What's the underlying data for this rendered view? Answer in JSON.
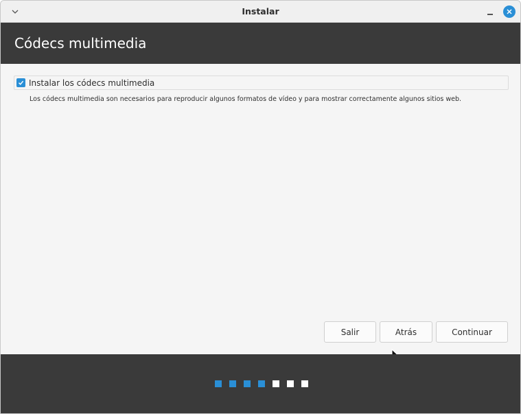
{
  "window": {
    "title": "Instalar"
  },
  "header": {
    "title": "Códecs multimedia"
  },
  "option": {
    "label": "Instalar los códecs multimedia",
    "checked": true
  },
  "description": "Los códecs multimedia son necesarios para reproducir algunos formatos de vídeo y para mostrar correctamente algunos sitios web.",
  "buttons": {
    "quit": "Salir",
    "back": "Atrás",
    "continue": "Continuar"
  },
  "progress": {
    "total_steps": 7,
    "completed_steps": 4,
    "active_color": "#2a8fd6",
    "inactive_color": "#ffffff"
  },
  "colors": {
    "accent": "#2a8fd6",
    "dark_band": "#3a3a3a"
  },
  "icons": {
    "window_menu": "chevron-down-icon",
    "minimize": "minimize-icon",
    "close": "close-icon",
    "checkbox": "check-icon"
  }
}
